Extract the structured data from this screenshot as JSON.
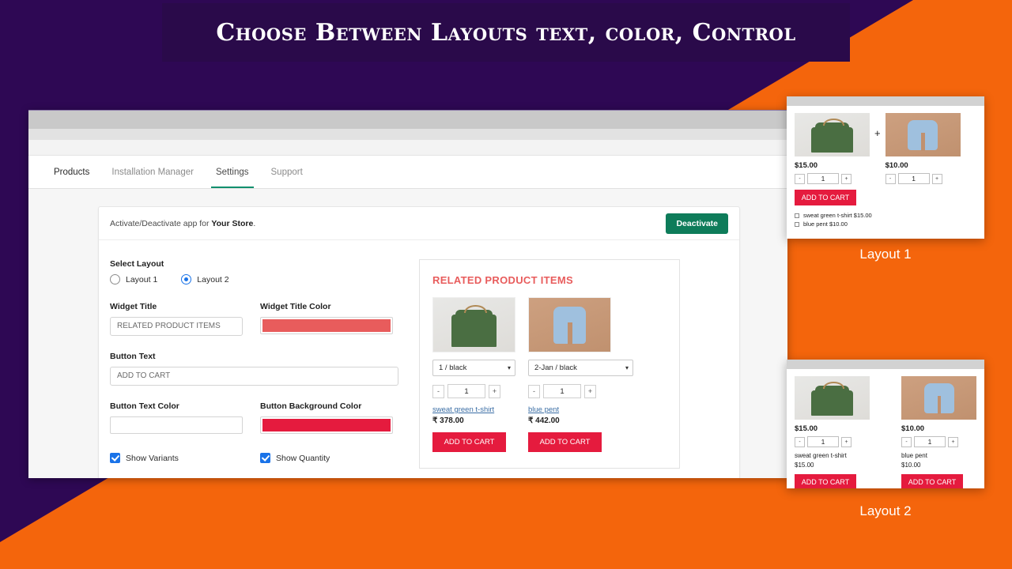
{
  "banner": {
    "title": "Choose Between Layouts text, color, Control"
  },
  "theme": {
    "purple": "#2E0854",
    "orange": "#F4650C",
    "accent_green": "#0E7C5A",
    "accent_red": "#E51B3E",
    "title_color": "#E85C5C",
    "tab_active": "#128f6e",
    "radio_blue": "#1a73e8"
  },
  "tabs": [
    {
      "label": "Products",
      "active": false
    },
    {
      "label": "Installation Manager",
      "active": false
    },
    {
      "label": "Settings",
      "active": true
    },
    {
      "label": "Support",
      "active": false
    }
  ],
  "activate": {
    "text_prefix": "Activate/Deactivate app for ",
    "store_name": "Your Store",
    "text_suffix": ".",
    "button_label": "Deactivate"
  },
  "form": {
    "select_layout_label": "Select Layout",
    "layout_options": [
      {
        "label": "Layout 1",
        "selected": false
      },
      {
        "label": "Layout 2",
        "selected": true
      }
    ],
    "widget_title_label": "Widget Title",
    "widget_title_value": "RELATED PRODUCT ITEMS",
    "widget_title_color_label": "Widget Title Color",
    "widget_title_color_value": "#E85C5C",
    "button_text_label": "Button Text",
    "button_text_value": "ADD TO CART",
    "button_text_color_label": "Button Text Color",
    "button_text_color_value": "#FFFFFF",
    "button_bg_color_label": "Button Background Color",
    "button_bg_color_value": "#E51B3E",
    "show_variants_label": "Show Variants",
    "show_variants_checked": true,
    "show_quantity_label": "Show Quantity",
    "show_quantity_checked": true
  },
  "preview": {
    "title": "RELATED PRODUCT ITEMS",
    "products": [
      {
        "variant": "1 / black",
        "qty_minus": "-",
        "qty_value": "1",
        "qty_plus": "+",
        "name": "sweat green t-shirt",
        "price": "₹ 378.00",
        "cart_label": "ADD TO CART"
      },
      {
        "variant": "2-Jan / black",
        "qty_minus": "-",
        "qty_value": "1",
        "qty_plus": "+",
        "name": "blue pent",
        "price": "₹ 442.00",
        "cart_label": "ADD TO CART"
      }
    ]
  },
  "layout1": {
    "caption": "Layout 1",
    "plus_sign": "+",
    "products": [
      {
        "price": "$15.00",
        "qty_minus": "-",
        "qty_value": "1",
        "qty_plus": "+"
      },
      {
        "price": "$10.00",
        "qty_minus": "-",
        "qty_value": "1",
        "qty_plus": "+"
      }
    ],
    "cart_label": "ADD TO CART",
    "list": [
      "sweat green t-shirt $15.00",
      "blue pent $10.00"
    ]
  },
  "layout2": {
    "caption": "Layout 2",
    "products": [
      {
        "price": "$15.00",
        "qty_minus": "-",
        "qty_value": "1",
        "qty_plus": "+",
        "name": "sweat green t-shirt",
        "name_price": "$15.00",
        "cart_label": "ADD TO CART"
      },
      {
        "price": "$10.00",
        "qty_minus": "-",
        "qty_value": "1",
        "qty_plus": "+",
        "name": "blue pent",
        "name_price": "$10.00",
        "cart_label": "ADD TO CART"
      }
    ]
  }
}
